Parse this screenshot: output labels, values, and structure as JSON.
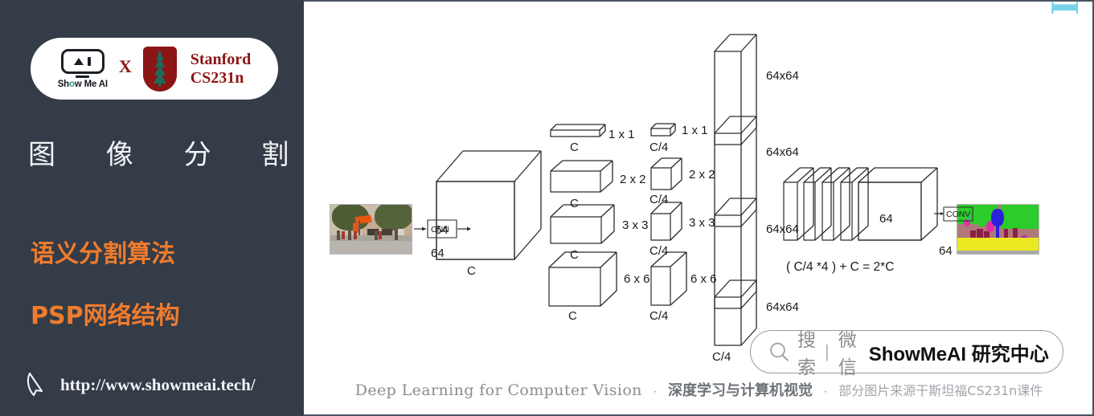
{
  "sidebar": {
    "badge": {
      "logo_word": "Show Me AI",
      "logo_word_pre": "Sh",
      "logo_word_dot": "o",
      "logo_word_post": "w Me AI",
      "cross": "X",
      "stanford_line1": "Stanford",
      "stanford_line2": "CS231n"
    },
    "title": "图 像 分 割",
    "subtitle_1": "语义分割算法",
    "subtitle_2": "PSP网络结构",
    "url": "http://www.showmeai.tech/",
    "colors": {
      "background": "#343c48",
      "accent_orange": "#F07B2C",
      "title_white": "#f2f4f7",
      "stanford_red": "#8C1515"
    }
  },
  "figure": {
    "input_label": "CNN",
    "output_label": "CONV",
    "feature_cube": {
      "height": "64",
      "depth": "64",
      "channels": "C"
    },
    "pyramid_left": [
      {
        "size": "1 x 1",
        "channels": "C"
      },
      {
        "size": "2 x 2",
        "channels": "C"
      },
      {
        "size": "3 x 3",
        "channels": "C"
      },
      {
        "size": "6 x 6",
        "channels": "C"
      }
    ],
    "pyramid_right": [
      {
        "size": "1 x 1",
        "channels": "C/4"
      },
      {
        "size": "2 x 2",
        "channels": "C/4"
      },
      {
        "size": "3 x 3",
        "channels": "C/4"
      },
      {
        "size": "6 x 6",
        "channels": "C/4"
      }
    ],
    "upsampled_slabs": [
      {
        "size": "64x64"
      },
      {
        "size": "64x64"
      },
      {
        "size": "64x64"
      },
      {
        "size": "64x64"
      }
    ],
    "upsampled_channels": "C/4",
    "concat_block": {
      "height": "64",
      "depth": "64",
      "formula": "( C/4 *4 ) + C = 2*C"
    }
  },
  "watermarks": {
    "vertical_brand": "ShowMeAI",
    "search_cn": "搜索",
    "search_sep": "|",
    "wechat_cn": "微信",
    "brand_en": "ShowMeAI ",
    "brand_cn": "研究中心"
  },
  "caption": {
    "en": "Deep Learning for Computer Vision",
    "dot1": "·",
    "cn_bold": "深度学习与计算机视觉",
    "dot2": "·",
    "cn_light": "部分图片来源干斯坦福CS231n课件"
  }
}
